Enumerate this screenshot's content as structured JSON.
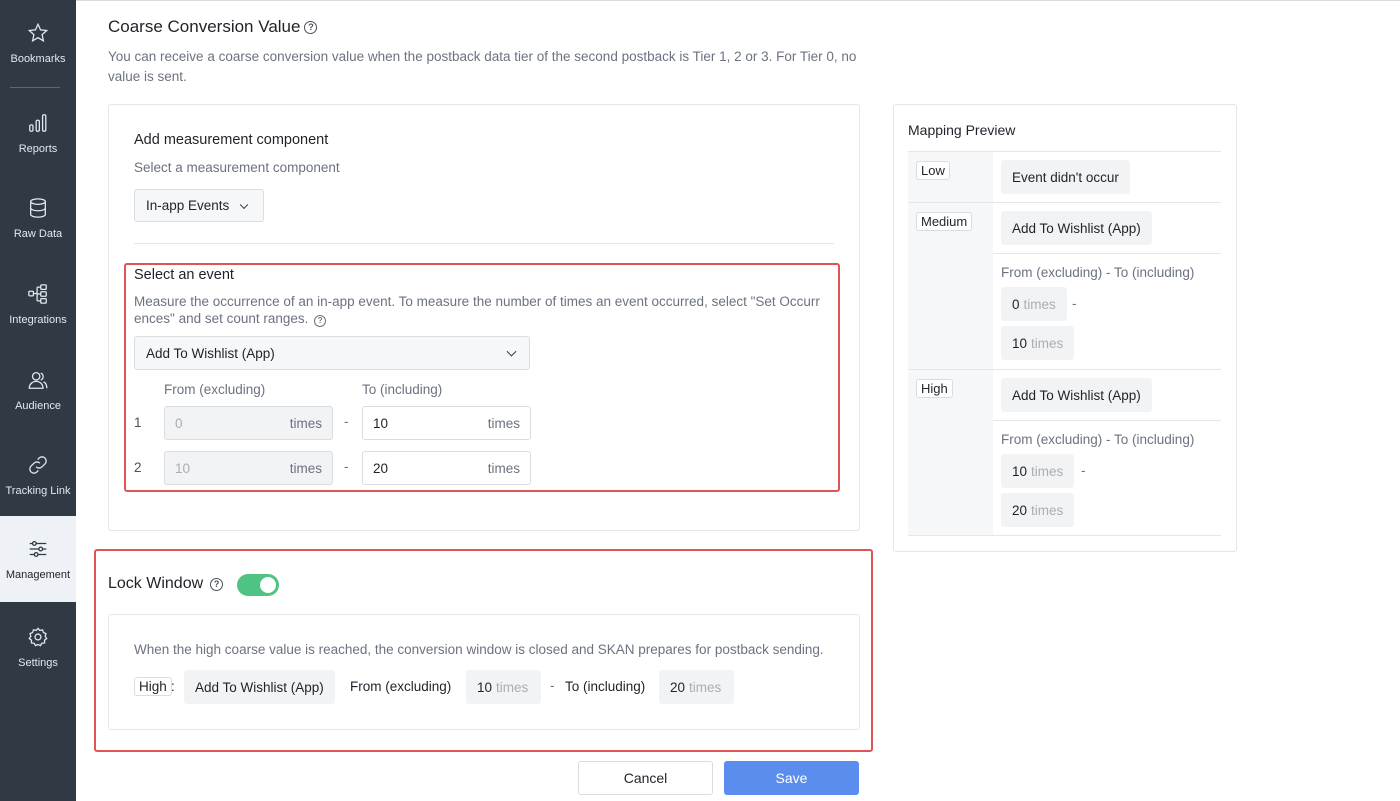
{
  "sidebar": {
    "items": [
      {
        "label": "Bookmarks",
        "icon": "star-icon"
      },
      {
        "label": "Reports",
        "icon": "bar-chart-icon"
      },
      {
        "label": "Raw Data",
        "icon": "database-icon"
      },
      {
        "label": "Integrations",
        "icon": "integrations-icon"
      },
      {
        "label": "Audience",
        "icon": "audience-icon"
      },
      {
        "label": "Tracking Link",
        "icon": "link-icon"
      },
      {
        "label": "Management",
        "icon": "sliders-icon",
        "active": true
      },
      {
        "label": "Settings",
        "icon": "gear-icon"
      }
    ]
  },
  "coarse": {
    "title": "Coarse Conversion Value",
    "description": "You can receive a coarse conversion value when the postback data tier of the second postback is Tier 1, 2 or 3. For Tier 0, no value is sent."
  },
  "measurement": {
    "heading": "Add measurement component",
    "subtext": "Select a measurement component",
    "dropdown_value": "In-app Events"
  },
  "event": {
    "heading": "Select an event",
    "description": "Measure the occurrence of an in-app event. To measure the number of times an event occurred, select \"Set Occurrences\" and set count ranges.",
    "desc_line1": "Measure the occurrence of an in-app event. To measure the number of times an event occurred, select \"Set Occurr",
    "desc_line2": "ences\" and set count ranges.",
    "selected_event": "Add To Wishlist (App)",
    "from_header": "From (excluding)",
    "to_header": "To (including)",
    "unit": "times",
    "dash": "-",
    "rows": [
      {
        "num": "1",
        "from": "0",
        "to": "10"
      },
      {
        "num": "2",
        "from": "10",
        "to": "20"
      }
    ]
  },
  "mapping": {
    "title": "Mapping Preview",
    "low": {
      "tag": "Low",
      "value": "Event didn't occur"
    },
    "medium": {
      "tag": "Medium",
      "event": "Add To Wishlist (App)",
      "range_label": "From (excluding) - To (including)",
      "from": "0",
      "to": "10"
    },
    "high": {
      "tag": "High",
      "event": "Add To Wishlist (App)",
      "range_label": "From (excluding) - To (including)",
      "from": "10",
      "to": "20"
    },
    "unit": "times",
    "dash": "-"
  },
  "lock": {
    "title": "Lock Window",
    "enabled": true,
    "description": "When the high coarse value is reached, the conversion window is closed and SKAN prepares for postback sending.",
    "tag": "High",
    "colon": ":",
    "event": "Add To Wishlist (App)",
    "from_label": "From (excluding)",
    "from_value": "10",
    "to_label": "To (including)",
    "to_value": "20",
    "unit": "times",
    "dash": "-"
  },
  "actions": {
    "cancel": "Cancel",
    "save": "Save"
  },
  "colors": {
    "highlight_border": "#e05456",
    "toggle_on": "#4fc482",
    "primary": "#5b8def",
    "sidebar_bg": "#2f3a44"
  }
}
